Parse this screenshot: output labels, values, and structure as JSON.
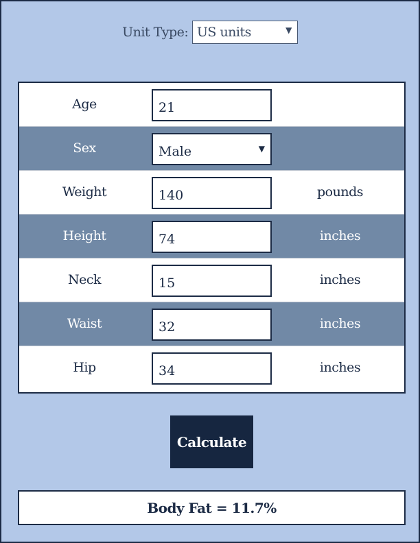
{
  "unit_type": {
    "label": "Unit Type:",
    "value": "US units"
  },
  "rows": [
    {
      "label": "Age",
      "value": "21",
      "unit": ""
    },
    {
      "label": "Sex",
      "value": "Male",
      "unit": ""
    },
    {
      "label": "Weight",
      "value": "140",
      "unit": "pounds"
    },
    {
      "label": "Height",
      "value": "74",
      "unit": "inches"
    },
    {
      "label": "Neck",
      "value": "15",
      "unit": "inches"
    },
    {
      "label": "Waist",
      "value": "32",
      "unit": "inches"
    },
    {
      "label": "Hip",
      "value": "34",
      "unit": "inches"
    }
  ],
  "calculate_label": "Calculate",
  "result": "Body Fat = 11.7%",
  "colors": {
    "background": "#b3c8e8",
    "row_dark": "#7189a6",
    "button": "#162640",
    "border": "#1c2b45"
  }
}
